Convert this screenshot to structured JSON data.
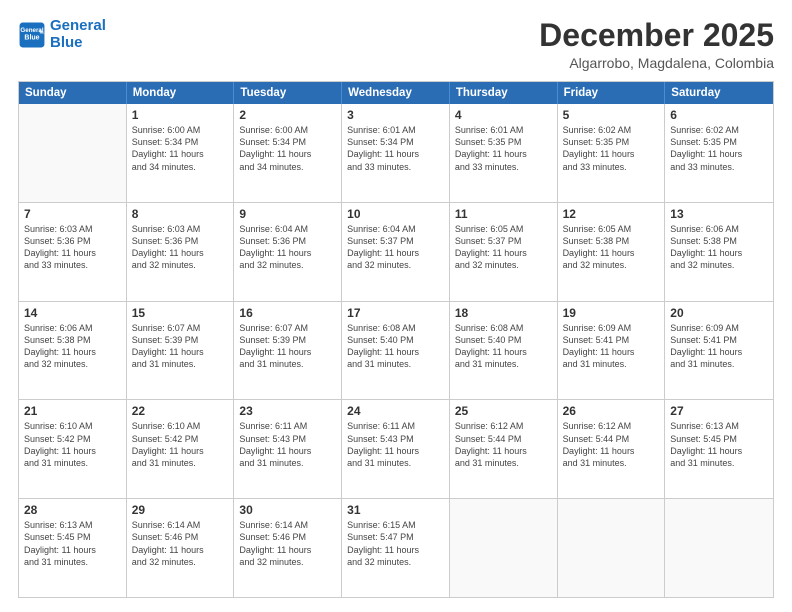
{
  "header": {
    "logo_line1": "General",
    "logo_line2": "Blue",
    "month": "December 2025",
    "location": "Algarrobo, Magdalena, Colombia"
  },
  "weekdays": [
    "Sunday",
    "Monday",
    "Tuesday",
    "Wednesday",
    "Thursday",
    "Friday",
    "Saturday"
  ],
  "weeks": [
    [
      {
        "day": "",
        "info": ""
      },
      {
        "day": "1",
        "info": "Sunrise: 6:00 AM\nSunset: 5:34 PM\nDaylight: 11 hours\nand 34 minutes."
      },
      {
        "day": "2",
        "info": "Sunrise: 6:00 AM\nSunset: 5:34 PM\nDaylight: 11 hours\nand 34 minutes."
      },
      {
        "day": "3",
        "info": "Sunrise: 6:01 AM\nSunset: 5:34 PM\nDaylight: 11 hours\nand 33 minutes."
      },
      {
        "day": "4",
        "info": "Sunrise: 6:01 AM\nSunset: 5:35 PM\nDaylight: 11 hours\nand 33 minutes."
      },
      {
        "day": "5",
        "info": "Sunrise: 6:02 AM\nSunset: 5:35 PM\nDaylight: 11 hours\nand 33 minutes."
      },
      {
        "day": "6",
        "info": "Sunrise: 6:02 AM\nSunset: 5:35 PM\nDaylight: 11 hours\nand 33 minutes."
      }
    ],
    [
      {
        "day": "7",
        "info": "Sunrise: 6:03 AM\nSunset: 5:36 PM\nDaylight: 11 hours\nand 33 minutes."
      },
      {
        "day": "8",
        "info": "Sunrise: 6:03 AM\nSunset: 5:36 PM\nDaylight: 11 hours\nand 32 minutes."
      },
      {
        "day": "9",
        "info": "Sunrise: 6:04 AM\nSunset: 5:36 PM\nDaylight: 11 hours\nand 32 minutes."
      },
      {
        "day": "10",
        "info": "Sunrise: 6:04 AM\nSunset: 5:37 PM\nDaylight: 11 hours\nand 32 minutes."
      },
      {
        "day": "11",
        "info": "Sunrise: 6:05 AM\nSunset: 5:37 PM\nDaylight: 11 hours\nand 32 minutes."
      },
      {
        "day": "12",
        "info": "Sunrise: 6:05 AM\nSunset: 5:38 PM\nDaylight: 11 hours\nand 32 minutes."
      },
      {
        "day": "13",
        "info": "Sunrise: 6:06 AM\nSunset: 5:38 PM\nDaylight: 11 hours\nand 32 minutes."
      }
    ],
    [
      {
        "day": "14",
        "info": "Sunrise: 6:06 AM\nSunset: 5:38 PM\nDaylight: 11 hours\nand 32 minutes."
      },
      {
        "day": "15",
        "info": "Sunrise: 6:07 AM\nSunset: 5:39 PM\nDaylight: 11 hours\nand 31 minutes."
      },
      {
        "day": "16",
        "info": "Sunrise: 6:07 AM\nSunset: 5:39 PM\nDaylight: 11 hours\nand 31 minutes."
      },
      {
        "day": "17",
        "info": "Sunrise: 6:08 AM\nSunset: 5:40 PM\nDaylight: 11 hours\nand 31 minutes."
      },
      {
        "day": "18",
        "info": "Sunrise: 6:08 AM\nSunset: 5:40 PM\nDaylight: 11 hours\nand 31 minutes."
      },
      {
        "day": "19",
        "info": "Sunrise: 6:09 AM\nSunset: 5:41 PM\nDaylight: 11 hours\nand 31 minutes."
      },
      {
        "day": "20",
        "info": "Sunrise: 6:09 AM\nSunset: 5:41 PM\nDaylight: 11 hours\nand 31 minutes."
      }
    ],
    [
      {
        "day": "21",
        "info": "Sunrise: 6:10 AM\nSunset: 5:42 PM\nDaylight: 11 hours\nand 31 minutes."
      },
      {
        "day": "22",
        "info": "Sunrise: 6:10 AM\nSunset: 5:42 PM\nDaylight: 11 hours\nand 31 minutes."
      },
      {
        "day": "23",
        "info": "Sunrise: 6:11 AM\nSunset: 5:43 PM\nDaylight: 11 hours\nand 31 minutes."
      },
      {
        "day": "24",
        "info": "Sunrise: 6:11 AM\nSunset: 5:43 PM\nDaylight: 11 hours\nand 31 minutes."
      },
      {
        "day": "25",
        "info": "Sunrise: 6:12 AM\nSunset: 5:44 PM\nDaylight: 11 hours\nand 31 minutes."
      },
      {
        "day": "26",
        "info": "Sunrise: 6:12 AM\nSunset: 5:44 PM\nDaylight: 11 hours\nand 31 minutes."
      },
      {
        "day": "27",
        "info": "Sunrise: 6:13 AM\nSunset: 5:45 PM\nDaylight: 11 hours\nand 31 minutes."
      }
    ],
    [
      {
        "day": "28",
        "info": "Sunrise: 6:13 AM\nSunset: 5:45 PM\nDaylight: 11 hours\nand 31 minutes."
      },
      {
        "day": "29",
        "info": "Sunrise: 6:14 AM\nSunset: 5:46 PM\nDaylight: 11 hours\nand 32 minutes."
      },
      {
        "day": "30",
        "info": "Sunrise: 6:14 AM\nSunset: 5:46 PM\nDaylight: 11 hours\nand 32 minutes."
      },
      {
        "day": "31",
        "info": "Sunrise: 6:15 AM\nSunset: 5:47 PM\nDaylight: 11 hours\nand 32 minutes."
      },
      {
        "day": "",
        "info": ""
      },
      {
        "day": "",
        "info": ""
      },
      {
        "day": "",
        "info": ""
      }
    ]
  ]
}
